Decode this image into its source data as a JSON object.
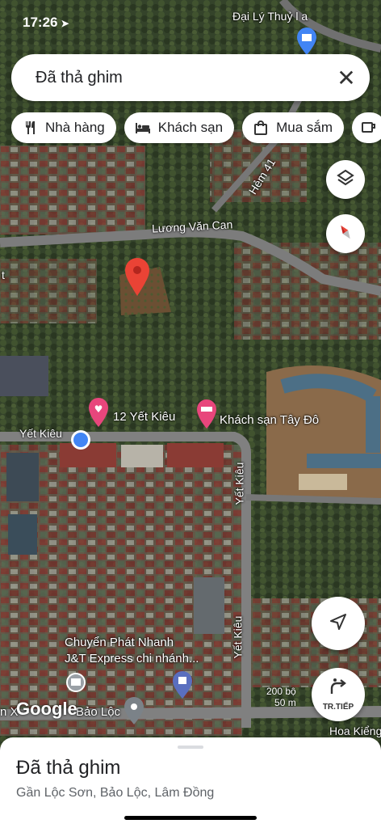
{
  "status": {
    "time": "17:26"
  },
  "search": {
    "query": "Đã thả ghim"
  },
  "chips": [
    {
      "label": "Nhà hàng",
      "icon": "fork-knife-icon"
    },
    {
      "label": "Khách sạn",
      "icon": "bed-icon"
    },
    {
      "label": "Mua sắm",
      "icon": "shopping-bag-icon"
    },
    {
      "label": "",
      "icon": "coffee-icon"
    }
  ],
  "map": {
    "labels": {
      "top_poi": "Đại Lý Thuỷ l a",
      "road_luong": "Lương Văn Can",
      "road_hem": "Hẻm 41",
      "road_yet_left": "Yết Kiêu",
      "road_yet_v1": "Yết Kiêu",
      "road_yet_v2": "Yết Kiêu",
      "poi_12": "12 Yết Kiêu",
      "poi_hotel": "Khách sạn Tây Đô",
      "poi_express1": "Chuyển Phát Nhanh",
      "poi_express2": "J&T Express chi nhánh...",
      "bottom_road": "n X",
      "bottom_road2": "Bảo Lộc",
      "bottom_right": "Hoa Kiểng",
      "left_edge": "t"
    },
    "scale": {
      "ft": "200 bộ",
      "m": "50 m"
    },
    "attribution": "Google"
  },
  "directions": {
    "label": "TR.TIẾP"
  },
  "sheet": {
    "title": "Đã thả ghim",
    "subtitle": "Gần Lộc Sơn, Bảo Lộc, Lâm Đồng"
  },
  "colors": {
    "pin_red": "#ea4335",
    "location_blue": "#4285f4",
    "poi_pink": "#e8467c"
  }
}
